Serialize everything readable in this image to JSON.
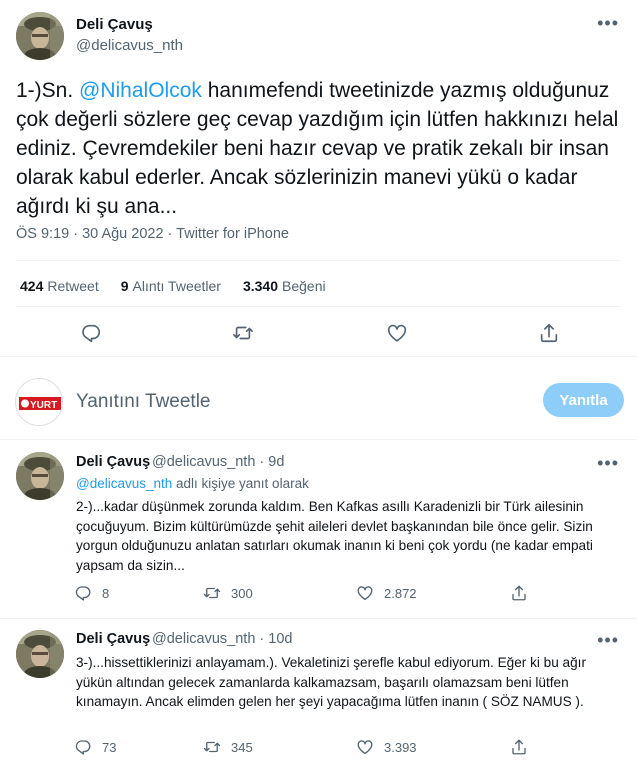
{
  "main_tweet": {
    "author_name": "Deli Çavuş",
    "author_handle": "@delicavus_nth",
    "text_prefix": "1-)Sn. ",
    "mention": "@NihalOlcok",
    "text_body": " hanımefendi tweetinizde yazmış olduğunuz çok değerli sözlere geç cevap yazdığım için lütfen hakkınızı helal ediniz. Çevremdekiler beni hazır cevap ve pratik zekalı bir insan olarak kabul ederler. Ancak sözlerinizin manevi yükü o kadar ağırdı ki şu ana...",
    "time": "ÖS 9:19",
    "sep": " · ",
    "date": "30 Ağu 2022",
    "source": "Twitter for iPhone",
    "retweets_count": "424",
    "retweets_label": "Retweet",
    "quotes_count": "9",
    "quotes_label": "Alıntı Tweetler",
    "likes_count": "3.340",
    "likes_label": "Beğeni"
  },
  "reply_box": {
    "avatar_text": "YURT",
    "placeholder": "Yanıtını Tweetle",
    "button_label": "Yanıtla"
  },
  "replies": [
    {
      "author_name": "Deli Çavuş",
      "author_handle": "@delicavus_nth",
      "time": "· 9d",
      "replying_mention": "@delicavus_nth",
      "replying_suffix": " adlı kişiye yanıt olarak",
      "text": "2-)...kadar düşünmek zorunda kaldım. Ben Kafkas asıllı Karadenizli bir Türk ailesinin çocuğuyum. Bizim kültürümüzde şehit aileleri devlet başkanından bile önce gelir. Sizin yorgun olduğunuzu anlatan satırları okumak inanın ki beni çok yordu (ne kadar empati yapsam da sizin...",
      "reply_count": "8",
      "retweet_count": "300",
      "like_count": "2.872"
    },
    {
      "author_name": "Deli Çavuş",
      "author_handle": "@delicavus_nth",
      "time": "· 10d",
      "text": "3-)...hissettiklerinizi anlayamam.).  Vekaletinizi şerefle kabul ediyorum. Eğer ki bu ağır yükün altından gelecek zamanlarda kalkamazsam, başarılı olamazsam beni lütfen kınamayın. Ancak elimden gelen her şeyi yapacağıma lütfen inanın ( SÖZ NAMUS ).",
      "reply_count": "73",
      "retweet_count": "345",
      "like_count": "3.393"
    }
  ],
  "colors": {
    "accent": "#1d9bf0",
    "secondary_text": "#536471",
    "divider": "#eff3f4",
    "reply_button_disabled": "#8ecdf8",
    "yurt_red": "#d71920"
  },
  "icons": {
    "more": "more-icon",
    "reply": "reply-icon",
    "retweet": "retweet-icon",
    "like": "like-icon",
    "share": "share-icon"
  }
}
